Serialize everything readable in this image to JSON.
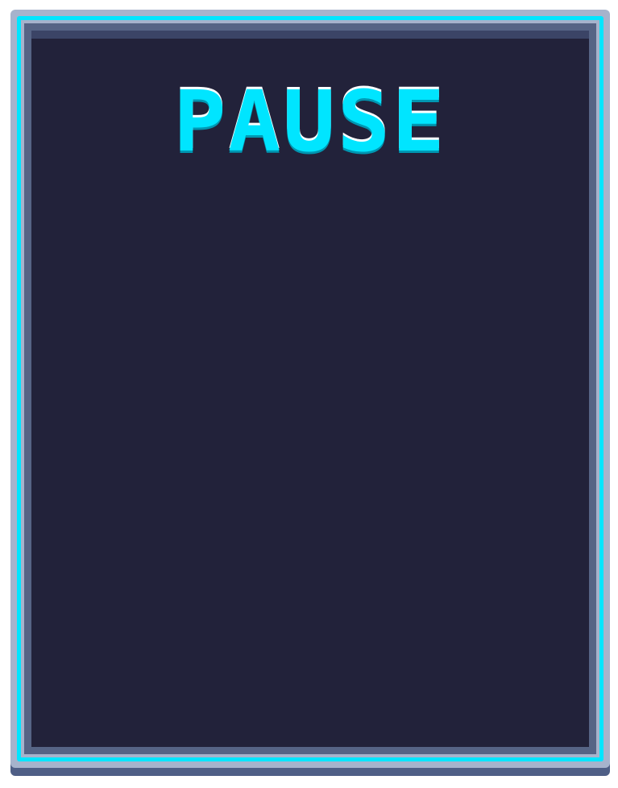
{
  "pause_menu": {
    "title": "PAUSE"
  },
  "colors": {
    "accent": "#00e5ff",
    "panel_bg": "#22223a",
    "frame_light": "#a6b3cc",
    "frame_dark": "#4f5f86",
    "band": "#3b4466"
  }
}
